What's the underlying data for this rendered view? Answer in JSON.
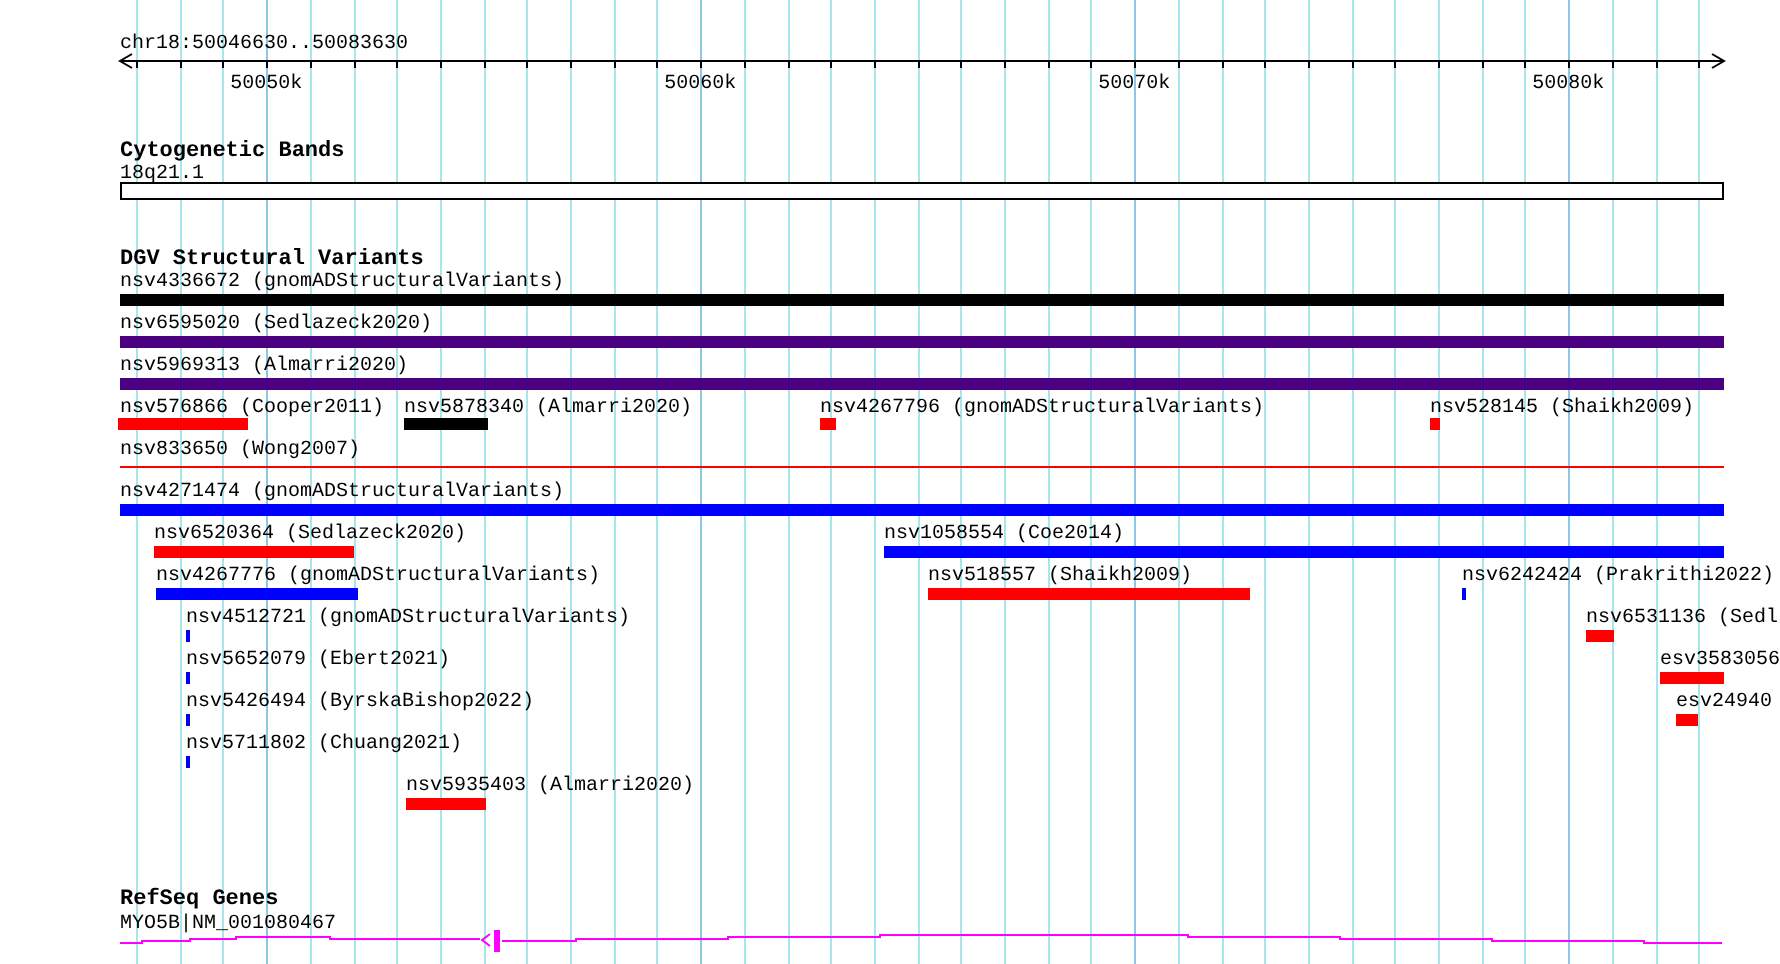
{
  "ruler": {
    "location": "chr18:50046630..50083630",
    "ticks": [
      "50050k",
      "50060k",
      "50070k",
      "50080k"
    ]
  },
  "tracks": [
    {
      "title": "Cytogenetic Bands",
      "features": [
        {
          "label": "18q21.1",
          "kind": "band"
        }
      ]
    },
    {
      "title": "DGV Structural Variants",
      "features": [
        {
          "label": "nsv4336672 (gnomADStructuralVariants)",
          "kind": "bar",
          "color": "#000000"
        },
        {
          "label": "nsv6595020 (Sedlazeck2020)",
          "kind": "bar",
          "color": "#4b0082"
        },
        {
          "label": "nsv5969313 (Almarri2020)",
          "kind": "bar",
          "color": "#4b0082"
        },
        {
          "label": "nsv576866 (Cooper2011)",
          "kind": "bar",
          "color": "#ff0000"
        },
        {
          "label": "nsv5878340 (Almarri2020)",
          "kind": "bar",
          "color": "#000000"
        },
        {
          "label": "nsv4267796 (gnomADStructuralVariants)",
          "kind": "bar",
          "color": "#ff0000"
        },
        {
          "label": "nsv528145 (Shaikh2009)",
          "kind": "bar",
          "color": "#ff0000"
        },
        {
          "label": "nsv833650 (Wong2007)",
          "kind": "line",
          "color": "#ff0000"
        },
        {
          "label": "nsv4271474 (gnomADStructuralVariants)",
          "kind": "bar",
          "color": "#0000ff"
        },
        {
          "label": "nsv6520364 (Sedlazeck2020)",
          "kind": "bar",
          "color": "#ff0000"
        },
        {
          "label": "nsv1058554 (Coe2014)",
          "kind": "bar",
          "color": "#0000ff"
        },
        {
          "label": "nsv4267776 (gnomADStructuralVariants)",
          "kind": "bar",
          "color": "#0000ff"
        },
        {
          "label": "nsv518557 (Shaikh2009)",
          "kind": "bar",
          "color": "#ff0000"
        },
        {
          "label": "nsv6242424 (Prakrithi2022)",
          "kind": "bar",
          "color": "#0000ff"
        },
        {
          "label": "nsv4512721 (gnomADStructuralVariants)",
          "kind": "bar",
          "color": "#0000ff"
        },
        {
          "label": "nsv6531136 (Sedl",
          "kind": "bar",
          "color": "#ff0000"
        },
        {
          "label": "nsv5652079 (Ebert2021)",
          "kind": "bar",
          "color": "#0000ff"
        },
        {
          "label": "esv3583056",
          "kind": "bar",
          "color": "#ff0000"
        },
        {
          "label": "nsv5426494 (ByrskaBishop2022)",
          "kind": "bar",
          "color": "#0000ff"
        },
        {
          "label": "esv24940",
          "kind": "bar",
          "color": "#ff0000"
        },
        {
          "label": "nsv5711802 (Chuang2021)",
          "kind": "bar",
          "color": "#0000ff"
        },
        {
          "label": "nsv5935403 (Almarri2020)",
          "kind": "bar",
          "color": "#ff0000"
        }
      ]
    },
    {
      "title": "RefSeq Genes",
      "features": [
        {
          "label": "MYO5B|NM_001080467",
          "kind": "gene",
          "color": "#ff00ff"
        }
      ]
    }
  ]
}
